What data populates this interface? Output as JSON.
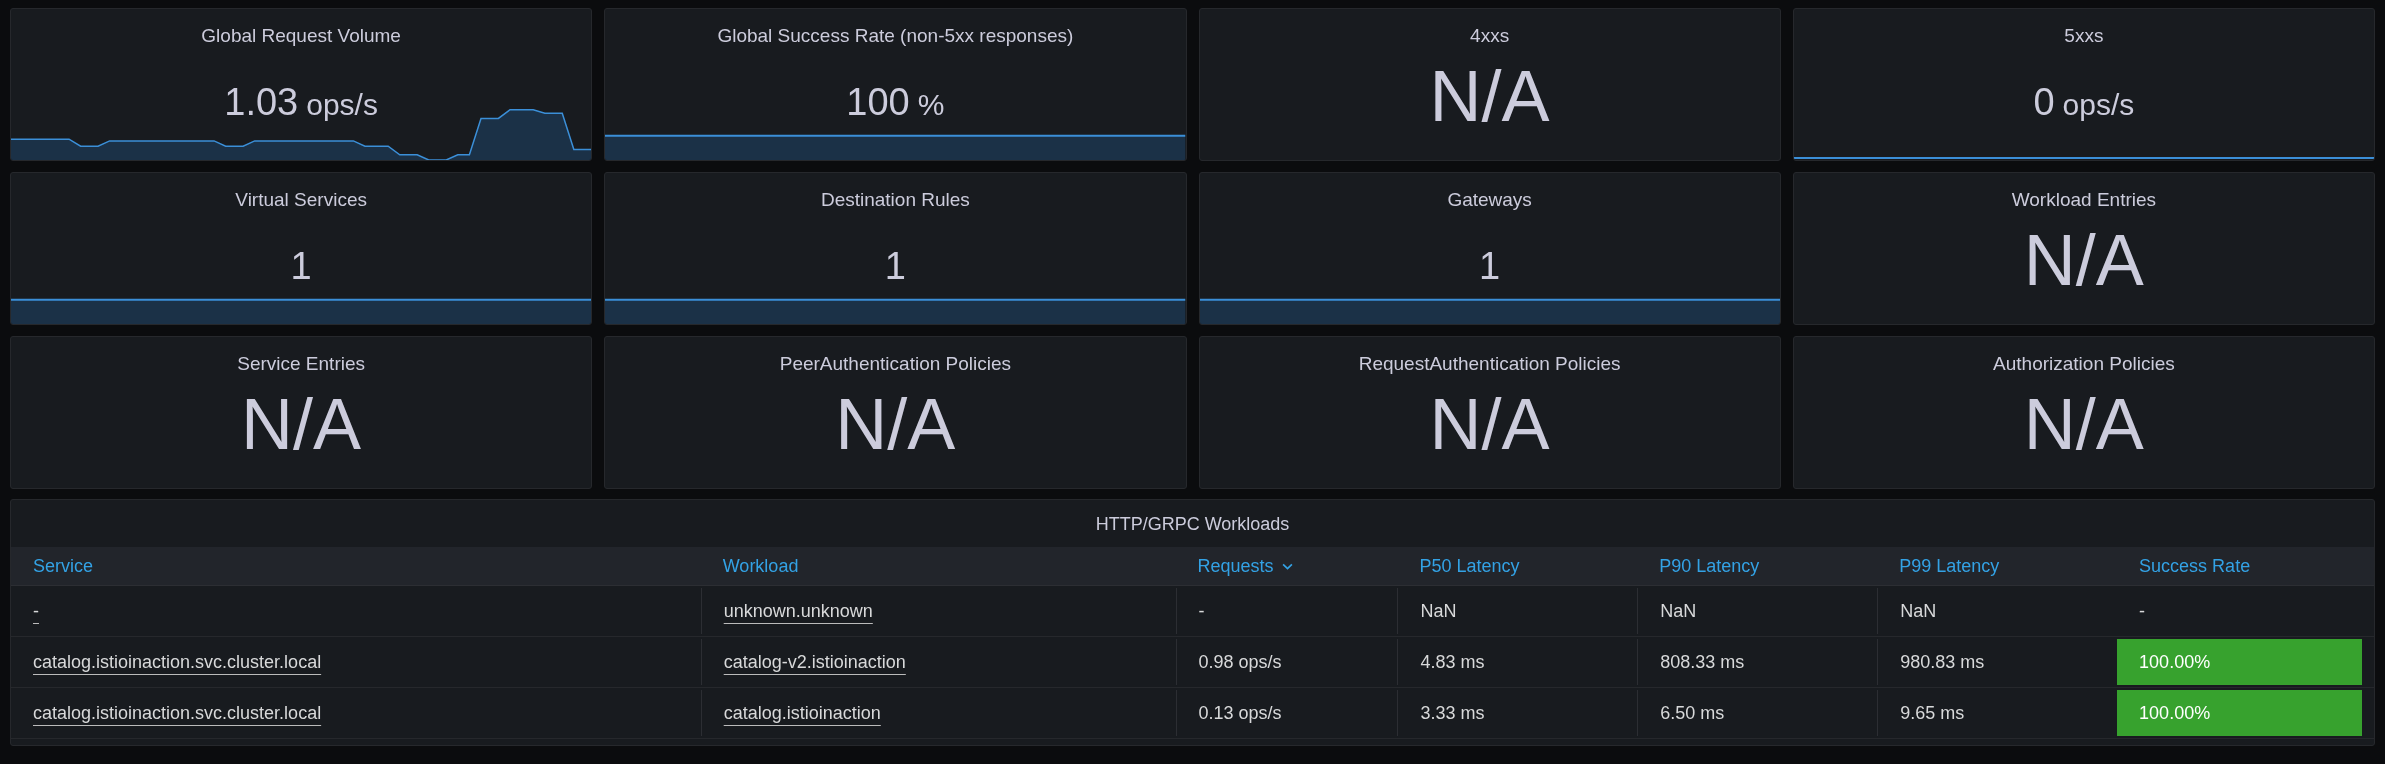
{
  "panels": [
    {
      "title": "Global Request Volume",
      "value": "1.03",
      "unit": "ops/s",
      "kind": "sparkline"
    },
    {
      "title": "Global Success Rate (non-5xx responses)",
      "value": "100",
      "unit": "%",
      "kind": "flat"
    },
    {
      "title": "4xxs",
      "value": "N/A",
      "kind": "none"
    },
    {
      "title": "5xxs",
      "value": "0",
      "unit": "ops/s",
      "kind": "baseline"
    },
    {
      "title": "Virtual Services",
      "value": "1",
      "kind": "flat"
    },
    {
      "title": "Destination Rules",
      "value": "1",
      "kind": "flat"
    },
    {
      "title": "Gateways",
      "value": "1",
      "kind": "flat"
    },
    {
      "title": "Workload Entries",
      "value": "N/A",
      "kind": "none"
    },
    {
      "title": "Service Entries",
      "value": "N/A",
      "kind": "none"
    },
    {
      "title": "PeerAuthentication Policies",
      "value": "N/A",
      "kind": "none"
    },
    {
      "title": "RequestAuthentication Policies",
      "value": "N/A",
      "kind": "none"
    },
    {
      "title": "Authorization Policies",
      "value": "N/A",
      "kind": "none"
    }
  ],
  "table": {
    "title": "HTTP/GRPC Workloads",
    "columns": [
      {
        "label": "Service",
        "sorted": false
      },
      {
        "label": "Workload",
        "sorted": false
      },
      {
        "label": "Requests",
        "sorted": true
      },
      {
        "label": "P50 Latency",
        "sorted": false
      },
      {
        "label": "P90 Latency",
        "sorted": false
      },
      {
        "label": "P99 Latency",
        "sorted": false
      },
      {
        "label": "Success Rate",
        "sorted": false
      }
    ],
    "rows": [
      [
        {
          "text": "-",
          "kind": "link"
        },
        {
          "text": "unknown.unknown",
          "kind": "link"
        },
        {
          "text": "-",
          "kind": "plain"
        },
        {
          "text": "NaN",
          "kind": "plain"
        },
        {
          "text": "NaN",
          "kind": "plain"
        },
        {
          "text": "NaN",
          "kind": "plain"
        },
        {
          "text": "-",
          "kind": "plain"
        }
      ],
      [
        {
          "text": "catalog.istioinaction.svc.cluster.local",
          "kind": "link"
        },
        {
          "text": "catalog-v2.istioinaction",
          "kind": "link"
        },
        {
          "text": "0.98 ops/s",
          "kind": "plain"
        },
        {
          "text": "4.83 ms",
          "kind": "plain"
        },
        {
          "text": "808.33 ms",
          "kind": "plain"
        },
        {
          "text": "980.83 ms",
          "kind": "plain"
        },
        {
          "text": "100.00%",
          "kind": "status",
          "color": "#37a22e"
        }
      ],
      [
        {
          "text": "catalog.istioinaction.svc.cluster.local",
          "kind": "link"
        },
        {
          "text": "catalog.istioinaction",
          "kind": "link"
        },
        {
          "text": "0.13 ops/s",
          "kind": "plain"
        },
        {
          "text": "3.33 ms",
          "kind": "plain"
        },
        {
          "text": "6.50 ms",
          "kind": "plain"
        },
        {
          "text": "9.65 ms",
          "kind": "plain"
        },
        {
          "text": "100.00%",
          "kind": "status",
          "color": "#37a22e"
        }
      ]
    ]
  }
}
